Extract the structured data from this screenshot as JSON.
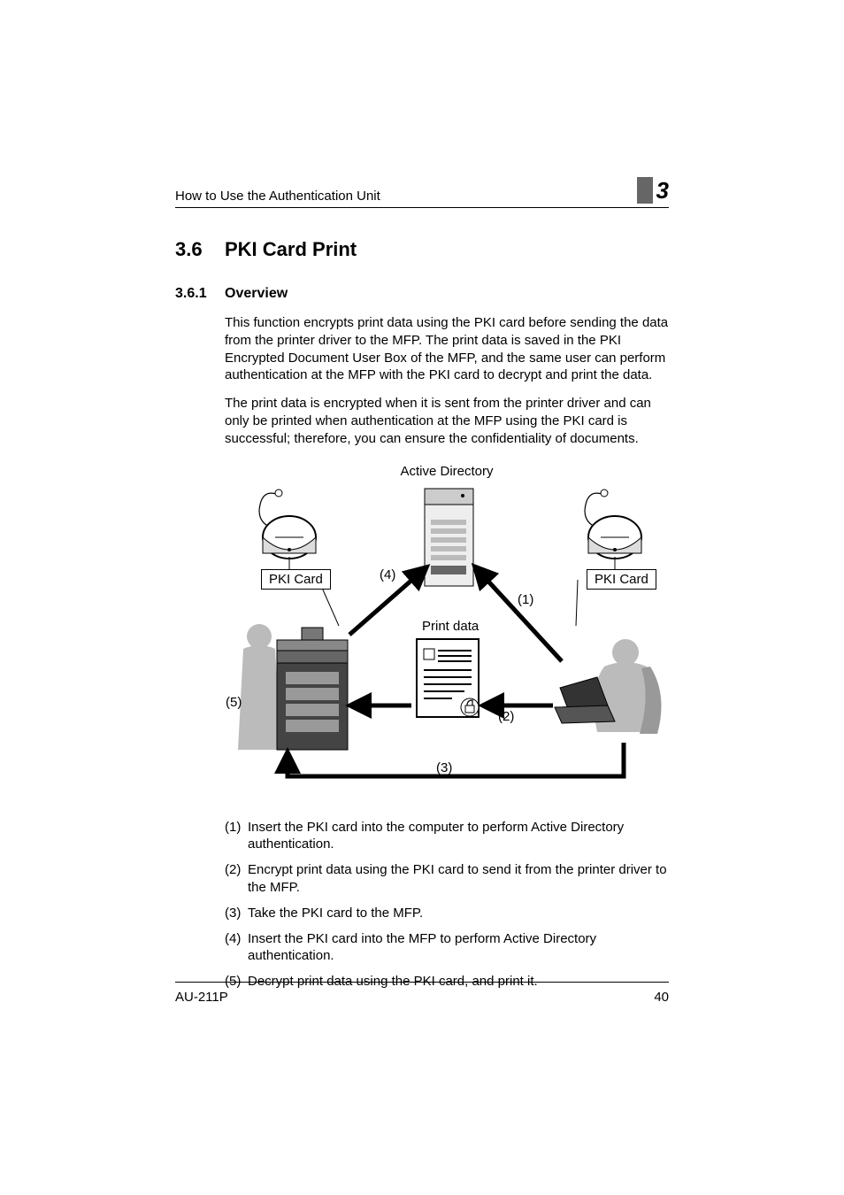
{
  "header": {
    "running_head": "How to Use the Authentication Unit",
    "chapter_number": "3"
  },
  "section": {
    "number": "3.6",
    "title": "PKI Card Print"
  },
  "subsection": {
    "number": "3.6.1",
    "title": "Overview"
  },
  "paragraphs": {
    "p1": "This function encrypts print data using the PKI card before sending the data from the printer driver to the MFP. The print data is saved in the PKI Encrypted Document User Box of the MFP, and the same user can perform authentication at the MFP with the PKI card to decrypt and print the data.",
    "p2": "The print data is encrypted when it is sent from the printer driver and can only be printed when authentication at the MFP using the PKI card is successful; therefore, you can ensure the confidentiality of documents."
  },
  "diagram": {
    "caption": "Active Directory",
    "labels": {
      "pki_card_left": "PKI Card",
      "pki_card_right": "PKI Card",
      "print_data": "Print data",
      "n1": "(1)",
      "n2": "(2)",
      "n3": "(3)",
      "n4": "(4)",
      "n5": "(5)"
    }
  },
  "steps": [
    {
      "n": "(1)",
      "t": "Insert the PKI card into the computer to perform Active Directory authentication."
    },
    {
      "n": "(2)",
      "t": "Encrypt print data using the PKI card to send it from the printer driver to the MFP."
    },
    {
      "n": "(3)",
      "t": "Take the PKI card to the MFP."
    },
    {
      "n": "(4)",
      "t": "Insert the PKI card into the MFP to perform Active Directory authentication."
    },
    {
      "n": "(5)",
      "t": "Decrypt print data using the PKI card, and print it."
    }
  ],
  "footer": {
    "model": "AU-211P",
    "page": "40"
  }
}
